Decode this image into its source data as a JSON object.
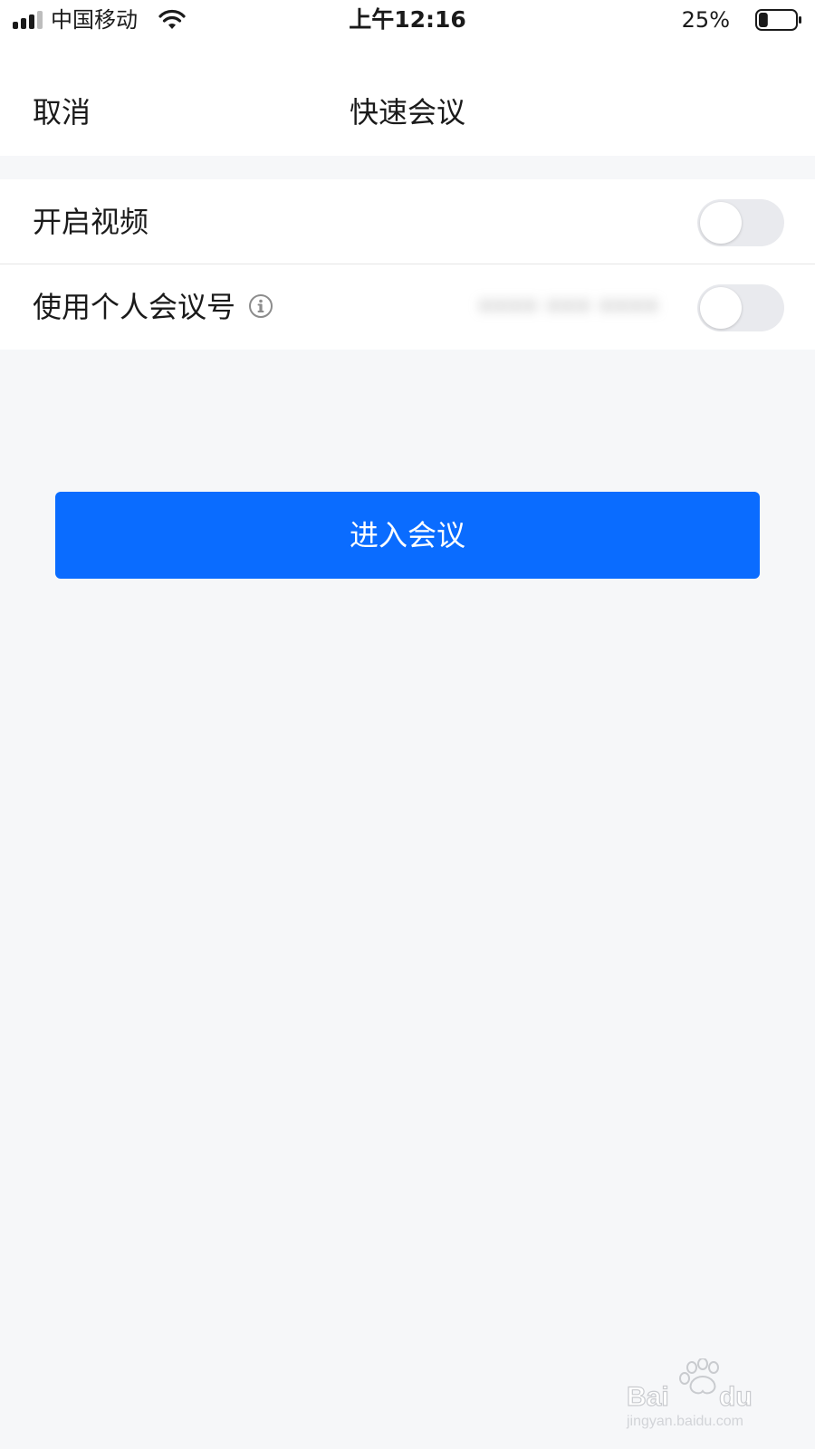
{
  "status_bar": {
    "carrier": "中国移动",
    "time": "上午12:16",
    "battery_percent": "25%",
    "battery_level": 0.25,
    "signal_bars": 3,
    "signal_bars_total": 4
  },
  "nav": {
    "cancel_label": "取消",
    "title": "快速会议"
  },
  "settings": [
    {
      "label": "开启视频",
      "enabled": false
    },
    {
      "label": "使用个人会议号",
      "enabled": false,
      "has_info": true,
      "value": "•••• ••• ••••"
    }
  ],
  "primary_action": {
    "label": "进入会议"
  },
  "colors": {
    "accent": "#0A6CFF",
    "background": "#F6F7F9",
    "toggle_off": "#E9EAEE"
  },
  "icons": {
    "signal": "cellular-signal-icon",
    "wifi": "wifi-icon",
    "battery": "battery-icon",
    "info": "info-icon",
    "watermark": "baidu-jingyan-watermark"
  }
}
